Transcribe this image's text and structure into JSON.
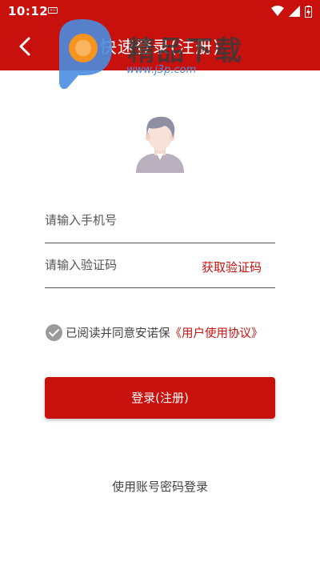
{
  "status_bar": {
    "time": "10:12",
    "icons": [
      "keyboard-icon",
      "wifi-icon",
      "cell-signal-icon",
      "battery-charging-icon"
    ]
  },
  "header": {
    "title": "快速登录(注册)",
    "back_icon": "back-arrow-icon",
    "background_color": "#c8100c"
  },
  "watermark": {
    "brand": "精品下载",
    "url": "www.j3p.com"
  },
  "form": {
    "phone_placeholder": "请输入手机号",
    "code_placeholder": "请输入验证码",
    "get_code_label": "获取验证码"
  },
  "agreement": {
    "checked": true,
    "text": "已阅读并同意安诺保",
    "link_text": "《用户使用协议》"
  },
  "login_button": "登录(注册)",
  "password_login_label": "使用账号密码登录",
  "colors": {
    "accent": "#c8100c",
    "text": "#444444",
    "check_gray": "#9a9a9a"
  }
}
